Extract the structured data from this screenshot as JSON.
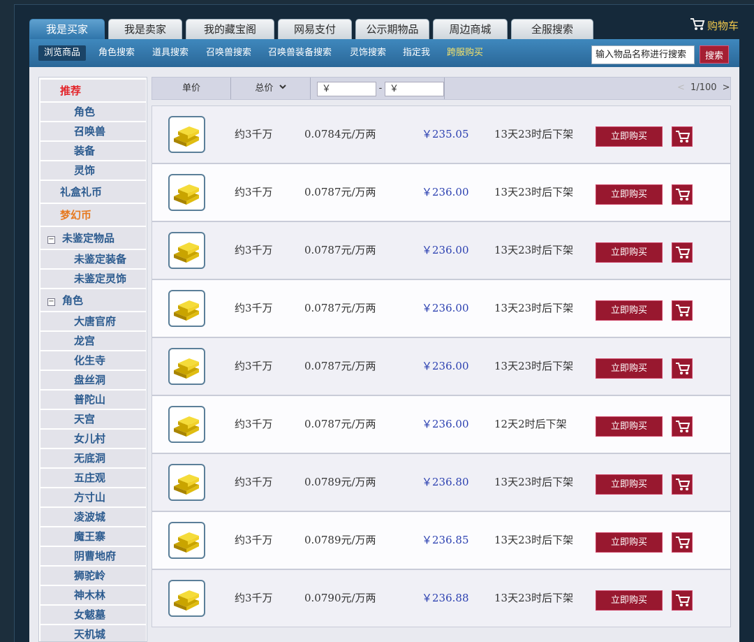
{
  "tabs": [
    {
      "label": "我是买家",
      "active": true
    },
    {
      "label": "我是卖家"
    },
    {
      "label": "我的藏宝阁"
    },
    {
      "label": "网易支付"
    },
    {
      "label": "公示期物品"
    },
    {
      "label": "周边商城"
    },
    {
      "label": "全服搜索"
    }
  ],
  "cart_label": "购物车",
  "subnav": [
    {
      "label": "浏览商品",
      "active": true
    },
    {
      "label": "角色搜索"
    },
    {
      "label": "道具搜索"
    },
    {
      "label": "召唤兽搜索"
    },
    {
      "label": "召唤兽装备搜索"
    },
    {
      "label": "灵饰搜索"
    },
    {
      "label": "指定我"
    },
    {
      "label": "跨服购买",
      "highlight": true
    }
  ],
  "search": {
    "placeholder": "输入物品名称进行搜索",
    "button": "搜索"
  },
  "sidebar": [
    {
      "label": "推荐",
      "kind": "cat",
      "color": "red"
    },
    {
      "label": "角色",
      "kind": "sub"
    },
    {
      "label": "召唤兽",
      "kind": "sub"
    },
    {
      "label": "装备",
      "kind": "sub"
    },
    {
      "label": "灵饰",
      "kind": "sub"
    },
    {
      "label": "礼盒礼币",
      "kind": "cat"
    },
    {
      "label": "梦幻币",
      "kind": "cat",
      "color": "orange"
    },
    {
      "label": "未鉴定物品",
      "kind": "group",
      "toggle": "−"
    },
    {
      "label": "未鉴定装备",
      "kind": "sub"
    },
    {
      "label": "未鉴定灵饰",
      "kind": "sub"
    },
    {
      "label": "角色",
      "kind": "group",
      "toggle": "−"
    },
    {
      "label": "大唐官府",
      "kind": "sub"
    },
    {
      "label": "龙宫",
      "kind": "sub"
    },
    {
      "label": "化生寺",
      "kind": "sub"
    },
    {
      "label": "盘丝洞",
      "kind": "sub"
    },
    {
      "label": "普陀山",
      "kind": "sub"
    },
    {
      "label": "天宫",
      "kind": "sub"
    },
    {
      "label": "女儿村",
      "kind": "sub"
    },
    {
      "label": "无底洞",
      "kind": "sub"
    },
    {
      "label": "五庄观",
      "kind": "sub"
    },
    {
      "label": "方寸山",
      "kind": "sub"
    },
    {
      "label": "凌波城",
      "kind": "sub"
    },
    {
      "label": "魔王寨",
      "kind": "sub"
    },
    {
      "label": "阴曹地府",
      "kind": "sub"
    },
    {
      "label": "狮驼岭",
      "kind": "sub"
    },
    {
      "label": "神木林",
      "kind": "sub"
    },
    {
      "label": "女魃墓",
      "kind": "sub"
    },
    {
      "label": "天机城",
      "kind": "sub"
    }
  ],
  "list_header": {
    "unit_price": "单价",
    "total_price": "总价",
    "min_price": "￥",
    "range_sep": "-",
    "max_price": "￥",
    "pager": "1/100"
  },
  "listings": [
    {
      "amount": "约3千万",
      "unit": "0.0784元/万两",
      "price": "￥235.05",
      "time_left": "13天23时后下架",
      "buy_label": "立即购买"
    },
    {
      "amount": "约3千万",
      "unit": "0.0787元/万两",
      "price": "￥236.00",
      "time_left": "13天23时后下架",
      "buy_label": "立即购买"
    },
    {
      "amount": "约3千万",
      "unit": "0.0787元/万两",
      "price": "￥236.00",
      "time_left": "13天23时后下架",
      "buy_label": "立即购买"
    },
    {
      "amount": "约3千万",
      "unit": "0.0787元/万两",
      "price": "￥236.00",
      "time_left": "13天23时后下架",
      "buy_label": "立即购买"
    },
    {
      "amount": "约3千万",
      "unit": "0.0787元/万两",
      "price": "￥236.00",
      "time_left": "13天23时后下架",
      "buy_label": "立即购买"
    },
    {
      "amount": "约3千万",
      "unit": "0.0787元/万两",
      "price": "￥236.00",
      "time_left": "12天2时后下架",
      "buy_label": "立即购买"
    },
    {
      "amount": "约3千万",
      "unit": "0.0789元/万两",
      "price": "￥236.80",
      "time_left": "13天23时后下架",
      "buy_label": "立即购买"
    },
    {
      "amount": "约3千万",
      "unit": "0.0789元/万两",
      "price": "￥236.85",
      "time_left": "13天23时后下架",
      "buy_label": "立即购买"
    },
    {
      "amount": "约3千万",
      "unit": "0.0790元/万两",
      "price": "￥236.88",
      "time_left": "13天23时后下架",
      "buy_label": "立即购买"
    }
  ]
}
